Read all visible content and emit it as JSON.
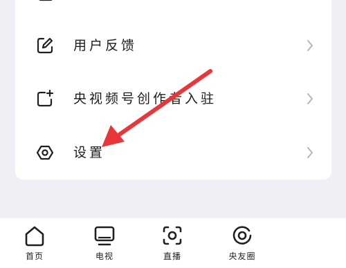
{
  "menu": {
    "items": [
      {
        "label": "用户反馈",
        "icon": "edit-icon"
      },
      {
        "label": "央视频号创作者入驻",
        "icon": "add-square-icon"
      },
      {
        "label": "设置",
        "icon": "settings-hexagon-icon"
      }
    ]
  },
  "tabbar": {
    "tabs": [
      {
        "label": "首页",
        "icon": "home-icon"
      },
      {
        "label": "电视",
        "icon": "tv-icon"
      },
      {
        "label": "直播",
        "icon": "live-icon"
      },
      {
        "label": "央友圈",
        "icon": "moments-icon"
      }
    ]
  },
  "colors": {
    "page_background": "#eef0f5",
    "card_background": "#ffffff",
    "annotation_arrow": "#e8363a",
    "chevron": "#b5b5b5"
  }
}
